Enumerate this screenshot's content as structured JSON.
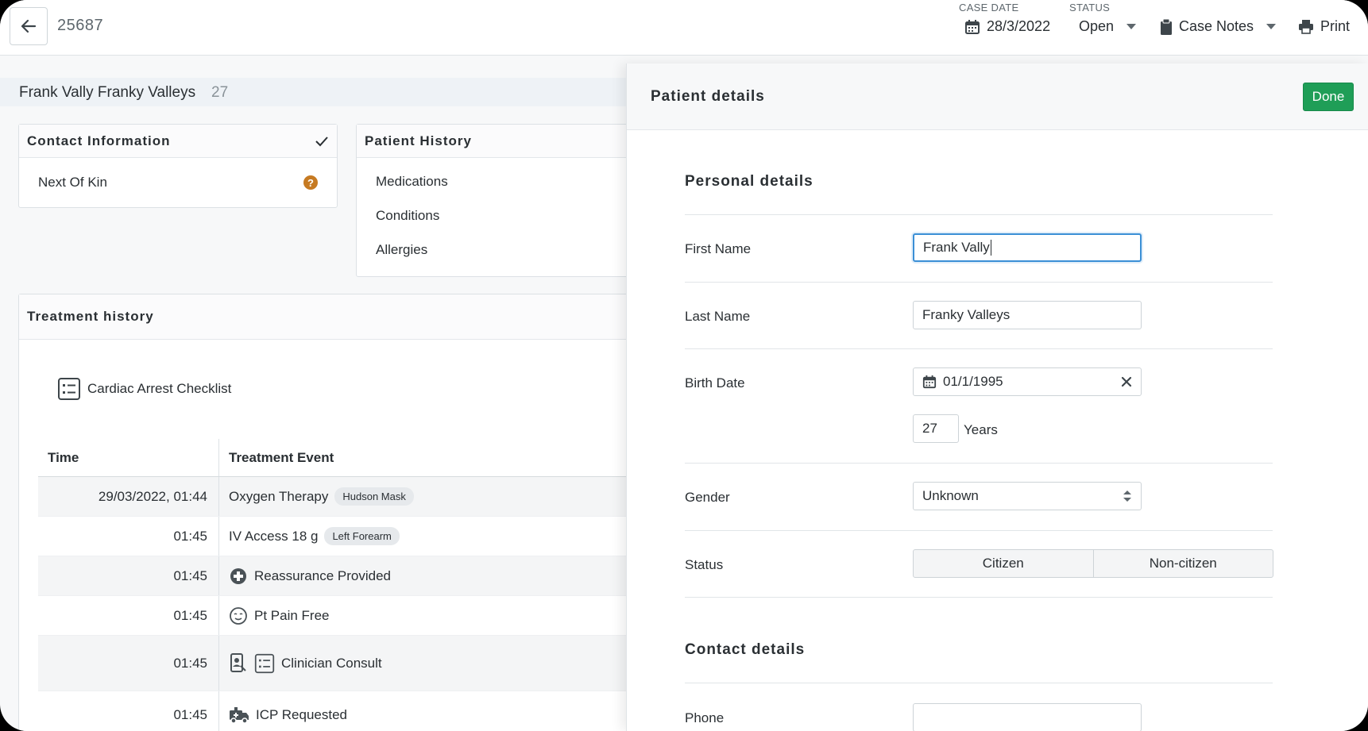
{
  "header": {
    "case_id": "25687",
    "case_date_label": "CASE DATE",
    "case_date": "28/3/2022",
    "status_label": "STATUS",
    "status_value": "Open",
    "case_notes_label": "Case Notes",
    "print_label": "Print"
  },
  "patient": {
    "name": "Frank Vally Franky Valleys",
    "age": "27"
  },
  "contact_card": {
    "title": "Contact Information",
    "items": [
      "Next Of Kin"
    ]
  },
  "history_card": {
    "title": "Patient History",
    "items": [
      "Medications",
      "Conditions",
      "Allergies"
    ]
  },
  "treatment": {
    "title": "Treatment history",
    "checklist_label": "Cardiac Arrest Checklist",
    "columns": [
      "Time",
      "Treatment Event"
    ],
    "rows": [
      {
        "time": "29/03/2022, 01:44",
        "event": "Oxygen Therapy",
        "tag": "Hudson Mask",
        "icon": ""
      },
      {
        "time": "01:45",
        "event": "IV Access 18 g",
        "tag": "Left Forearm",
        "icon": ""
      },
      {
        "time": "01:45",
        "event": "Reassurance Provided",
        "tag": "",
        "icon": "medical-cross-icon"
      },
      {
        "time": "01:45",
        "event": "Pt Pain Free",
        "tag": "",
        "icon": "calm-face-icon"
      },
      {
        "time": "01:45",
        "event": "Clinician Consult",
        "tag": "",
        "icon": "phone-consult-icon"
      },
      {
        "time": "01:45",
        "event": "ICP Requested",
        "tag": "",
        "icon": "ambulance-icon"
      }
    ]
  },
  "panel": {
    "title": "Patient details",
    "done_label": "Done",
    "personal_title": "Personal details",
    "first_name_label": "First Name",
    "first_name_value": "Frank Vally",
    "last_name_label": "Last Name",
    "last_name_value": "Franky Valleys",
    "birth_date_label": "Birth Date",
    "birth_date_value": "01/1/1995",
    "age_value": "27",
    "age_unit": "Years",
    "gender_label": "Gender",
    "gender_value": "Unknown",
    "status_label": "Status",
    "status_options": [
      "Citizen",
      "Non-citizen"
    ],
    "contact_title": "Contact details",
    "phone_label": "Phone",
    "phone_value": ""
  }
}
